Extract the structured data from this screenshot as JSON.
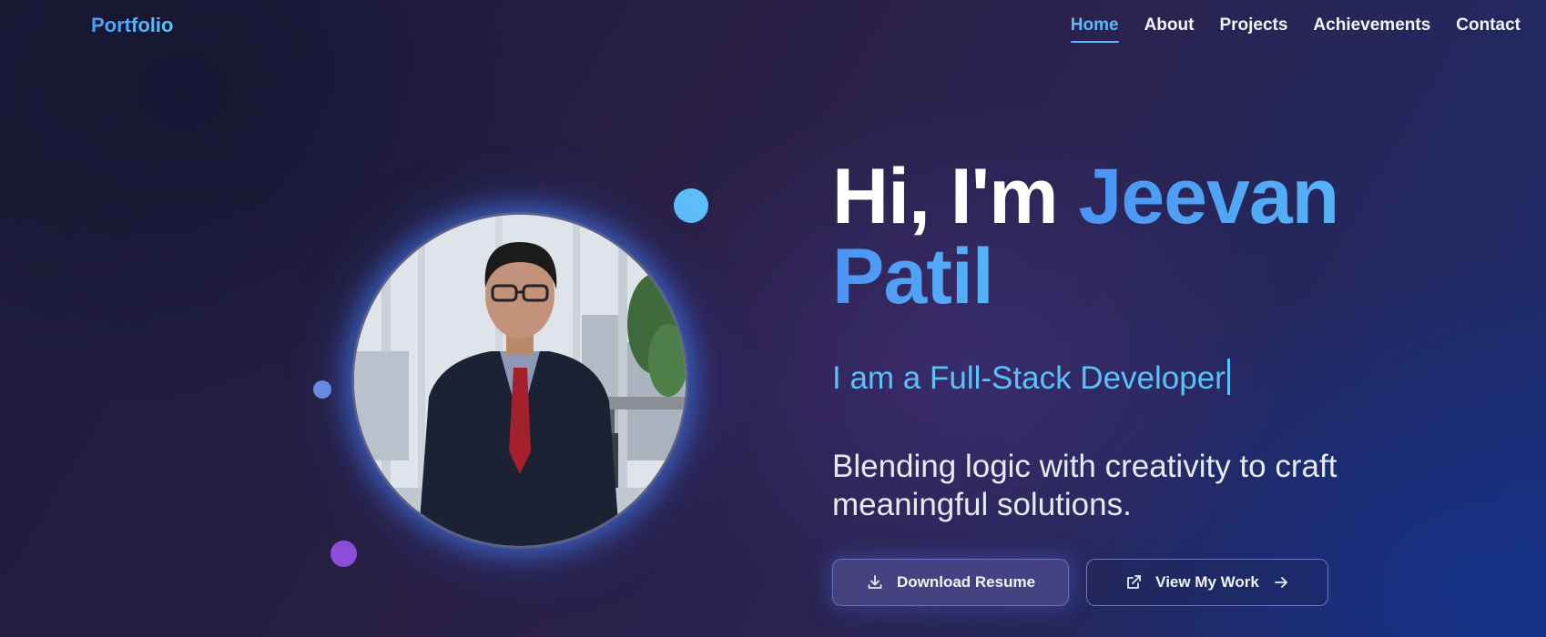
{
  "nav": {
    "brand": "Portfolio",
    "links": [
      "Home",
      "About",
      "Projects",
      "Achievements",
      "Contact"
    ],
    "active": "Home"
  },
  "hero": {
    "greeting": "Hi, I'm",
    "name_first": "Jeevan",
    "name_last": "Patil",
    "typed_text": "I am a Full-Stack Developer",
    "tagline": "Blending logic with creativity to craft meaningful solutions.",
    "primary_button": {
      "label": "Download Resume",
      "icon": "download-icon"
    },
    "secondary_button": {
      "label": "View My Work",
      "icon": "external-link-icon",
      "trailing_icon": "arrow-right-icon"
    }
  },
  "colors": {
    "accent_blue": "#4a93f3",
    "accent_cyan": "#5cc0f9",
    "dot_purple": "#8b4fdc",
    "background_dark": "#1c1c38"
  }
}
